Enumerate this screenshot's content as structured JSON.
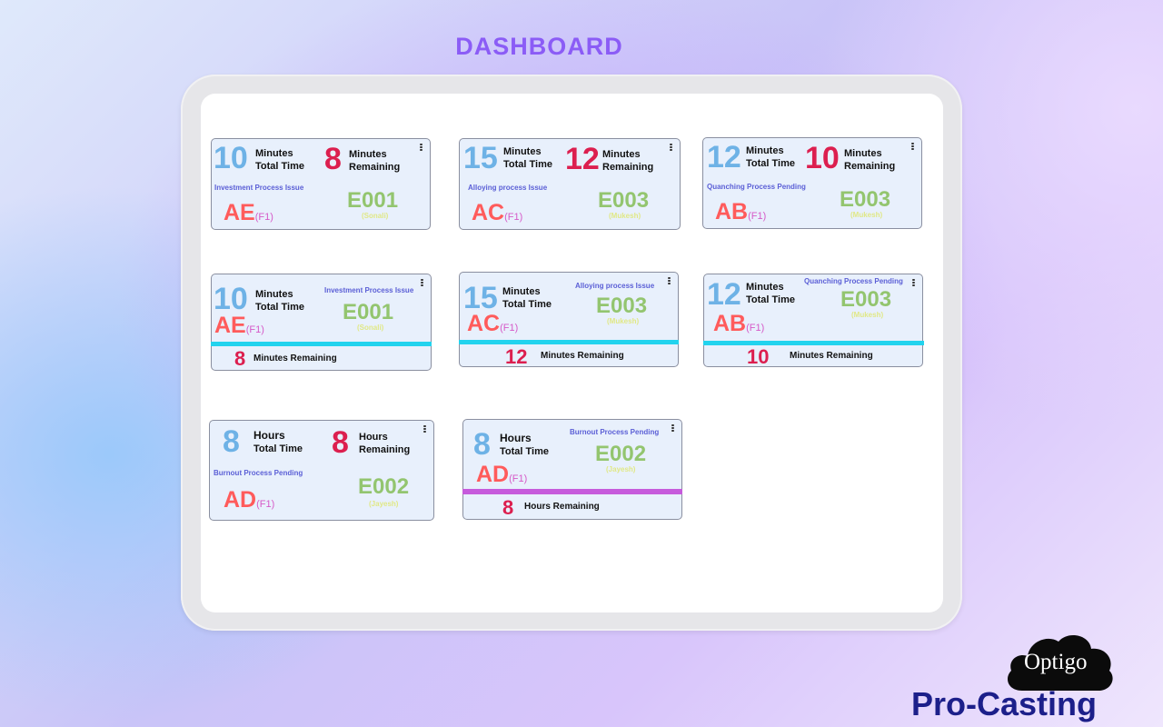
{
  "page": {
    "title": "DASHBOARD"
  },
  "brand": {
    "logo_text": "Optigo",
    "product": "Pro-Casting"
  },
  "colors": {
    "accent": "#8b5cf6",
    "total_blue": "#6eb2e6",
    "remaining_red": "#dc1f4f",
    "bar_cyan": "#22d3ee",
    "bar_purple": "#c65bdc",
    "brand_navy": "#1c1f8a"
  },
  "cards": [
    {
      "total": "10",
      "total_unit": "Minutes",
      "total_label": "Total Time",
      "remaining": "8",
      "remaining_unit": "Minutes",
      "remaining_label": "Remaining",
      "process": "Investment Process Issue",
      "employee": "E001",
      "employee_name": "(Sonali)",
      "code": "AE",
      "floor": "(F1)"
    },
    {
      "total": "15",
      "total_unit": "Minutes",
      "total_label": "Total Time",
      "remaining": "12",
      "remaining_unit": "Minutes",
      "remaining_label": "Remaining",
      "process": "Alloying process Issue",
      "employee": "E003",
      "employee_name": "(Mukesh)",
      "code": "AC",
      "floor": "(F1)"
    },
    {
      "total": "12",
      "total_unit": "Minutes",
      "total_label": "Total Time",
      "remaining": "10",
      "remaining_unit": "Minutes",
      "remaining_label": "Remaining",
      "process": "Quanching Process Pending",
      "employee": "E003",
      "employee_name": "(Mukesh)",
      "code": "AB",
      "floor": "(F1)"
    },
    {
      "total": "10",
      "total_unit": "Minutes",
      "total_label": "Total Time",
      "process": "Investment Process Issue",
      "employee": "E001",
      "employee_name": "(Sonali)",
      "code": "AE",
      "floor": "(F1)",
      "remaining": "8",
      "remaining_text": "Minutes  Remaining"
    },
    {
      "total": "15",
      "total_unit": "Minutes",
      "total_label": "Total Time",
      "process": "Alloying process Issue",
      "employee": "E003",
      "employee_name": "(Mukesh)",
      "code": "AC",
      "floor": "(F1)",
      "remaining": "12",
      "remaining_text": "Minutes Remaining"
    },
    {
      "total": "12",
      "total_unit": "Minutes",
      "total_label": "Total Time",
      "process": "Quanching Process Pending",
      "employee": "E003",
      "employee_name": "(Mukesh)",
      "code": "AB",
      "floor": "(F1)",
      "remaining": "10",
      "remaining_text": "Minutes Remaining"
    },
    {
      "total": "8",
      "total_unit": "Hours",
      "total_label": "Total Time",
      "remaining": "8",
      "remaining_unit": "Hours",
      "remaining_label": "Remaining",
      "process": "Burnout Process Pending",
      "employee": "E002",
      "employee_name": "(Jayesh)",
      "code": "AD",
      "floor": "(F1)"
    },
    {
      "total": "8",
      "total_unit": "Hours",
      "total_label": "Total Time",
      "process": "Burnout Process Pending",
      "employee": "E002",
      "employee_name": "(Jayesh)",
      "code": "AD",
      "floor": "(F1)",
      "remaining": "8",
      "remaining_text": "Hours Remaining"
    }
  ]
}
